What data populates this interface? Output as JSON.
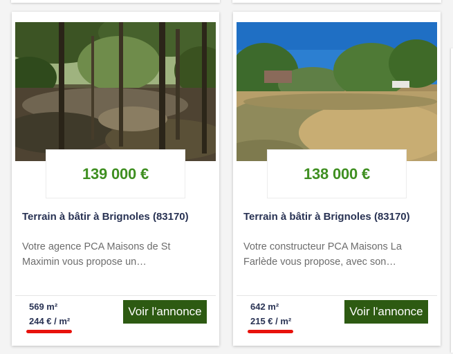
{
  "listings": [
    {
      "price": "139 000 €",
      "title": "Terrain à bâtir à Brignoles (83170)",
      "description": "Votre agence PCA Maisons de St Maximin vous propose un…",
      "area": "569 m²",
      "price_per_m2": "244 € / m²",
      "cta_label": "Voir l'annonce",
      "photo_icon": "forest-photo"
    },
    {
      "price": "138 000 €",
      "title": "Terrain à bâtir à Brignoles (83170)",
      "description": "Votre constructeur PCA Maisons La Farlède vous propose, avec son…",
      "area": "642 m²",
      "price_per_m2": "215 € / m²",
      "cta_label": "Voir l'annonce",
      "photo_icon": "meadow-photo"
    }
  ],
  "colors": {
    "price": "#3f8f21",
    "title": "#283253",
    "button": "#2d5a12",
    "highlight": "#e8120c"
  }
}
